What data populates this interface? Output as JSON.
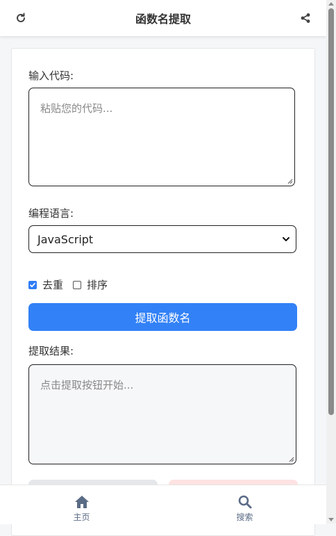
{
  "header": {
    "title": "函数名提取"
  },
  "input": {
    "label": "输入代码:",
    "placeholder": "粘贴您的代码..."
  },
  "language": {
    "label": "编程语言:",
    "selected": "JavaScript"
  },
  "options": {
    "dedupe_label": "去重",
    "dedupe_checked": true,
    "sort_label": "排序",
    "sort_checked": false
  },
  "actions": {
    "extract_label": "提取函数名"
  },
  "result": {
    "label": "提取结果:",
    "placeholder": "点击提取按钮开始..."
  },
  "nav": {
    "items": [
      {
        "label": "主页",
        "icon": "home-icon"
      },
      {
        "label": "搜索",
        "icon": "search-icon"
      }
    ]
  },
  "colors": {
    "accent": "#3281f6",
    "nav_text": "#5a6b85"
  }
}
